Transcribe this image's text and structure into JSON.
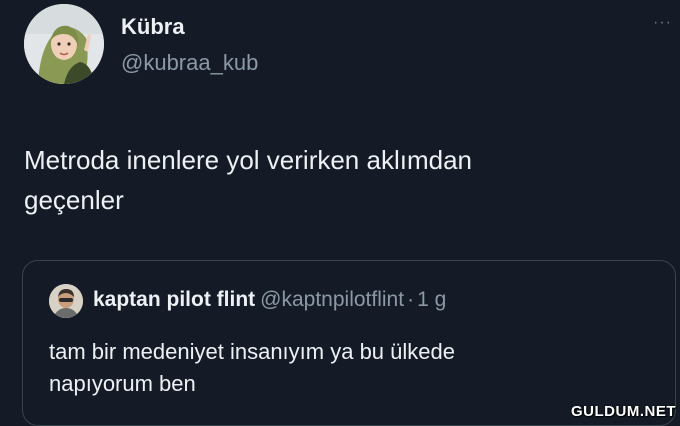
{
  "author": {
    "display_name": "Kübra",
    "handle": "@kubraa_kub",
    "avatar_icon": "profile-photo"
  },
  "more_icon": "more-dots-icon",
  "more_glyph": "···",
  "tweet": {
    "text_line1": "Metroda inenlere yol verirken aklımdan",
    "text_line2": "geçenler"
  },
  "quoted_tweet": {
    "display_name": "kaptan pilot flint",
    "handle": "@kaptnpilotflint",
    "separator": "·",
    "time": "1 g",
    "avatar_icon": "profile-photo",
    "text_line1": "tam bir medeniyet insanıyım ya bu ülkede",
    "text_line2": "napıyorum ben"
  },
  "watermark": "GULDUM.NET",
  "colors": {
    "background": "#141b27",
    "text_primary": "#eef1f3",
    "text_secondary": "#8b98a5",
    "border": "#38444d"
  }
}
